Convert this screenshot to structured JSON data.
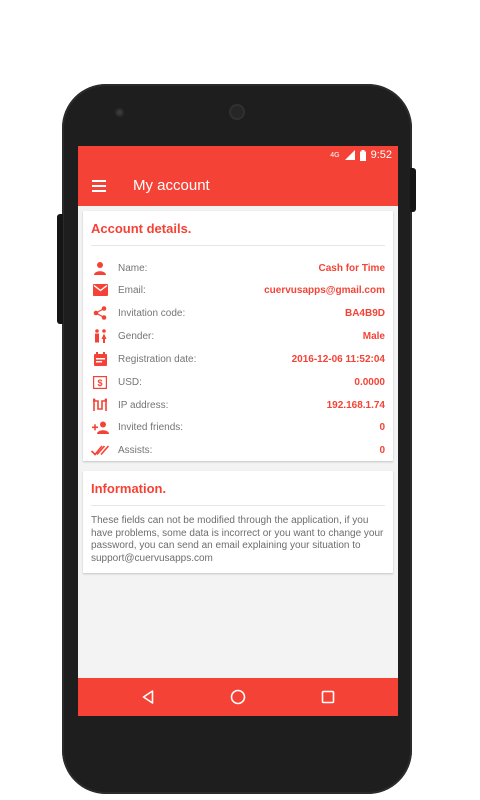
{
  "status": {
    "network": "4G",
    "time": "9:52"
  },
  "header": {
    "title": "My account"
  },
  "account": {
    "title": "Account details.",
    "rows": [
      {
        "icon": "person-icon",
        "label": "Name:",
        "value": "Cash for Time"
      },
      {
        "icon": "email-icon",
        "label": "Email:",
        "value": "cuervusapps@gmail.com"
      },
      {
        "icon": "share-icon",
        "label": "Invitation code:",
        "value": "BA4B9D"
      },
      {
        "icon": "gender-icon",
        "label": "Gender:",
        "value": "Male"
      },
      {
        "icon": "calendar-icon",
        "label": "Registration date:",
        "value": "2016-12-06 11:52:04"
      },
      {
        "icon": "dollar-icon",
        "label": "USD:",
        "value": "0.0000"
      },
      {
        "icon": "ip-icon",
        "label": "IP address:",
        "value": "192.168.1.74"
      },
      {
        "icon": "add-person-icon",
        "label": "Invited friends:",
        "value": "0"
      },
      {
        "icon": "double-check-icon",
        "label": "Assists:",
        "value": "0"
      }
    ]
  },
  "info": {
    "title": "Information.",
    "text": "These fields can not be modified through the application, if you have problems, some data is incorrect or you want to change your password, you can send an email explaining your situation to support@cuervusapps.com"
  },
  "colors": {
    "accent": "#f44336"
  }
}
